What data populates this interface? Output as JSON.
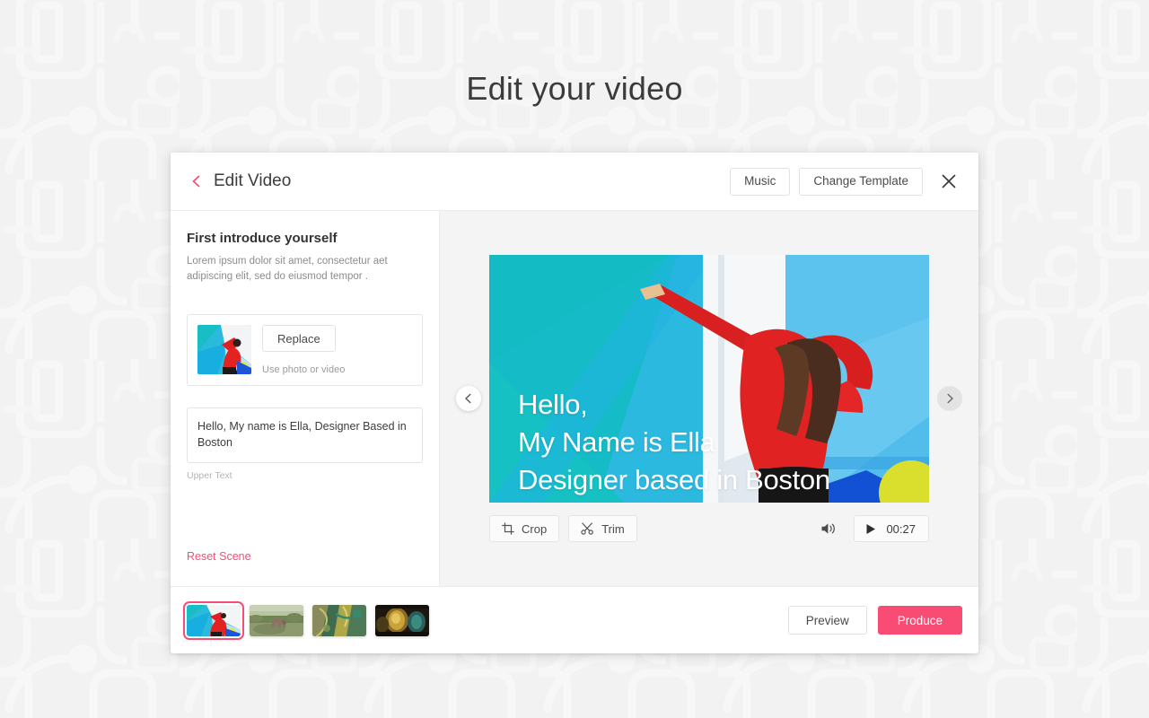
{
  "page": {
    "title": "Edit your video",
    "background_color": "#f2f2f2"
  },
  "modal": {
    "header": {
      "back_icon": "chevron-left-icon",
      "title": "Edit Video",
      "music_label": "Music",
      "change_template_label": "Change Template",
      "close_icon": "close-icon"
    },
    "sidebar": {
      "scene_heading": "First introduce yourself",
      "scene_description": "Lorem ipsum dolor sit amet, consectetur aet adipiscing elit, sed do eiusmod tempor .",
      "media": {
        "thumbnail_name": "scene-media-thumbnail",
        "replace_label": "Replace",
        "replace_hint": "Use photo or video"
      },
      "text_input": {
        "value": "Hello, My name is Ella, Designer Based in Boston",
        "placeholder": "Upper Text",
        "label": "Upper Text"
      },
      "reset_label": "Reset Scene",
      "reset_color": "#f94c75"
    },
    "preview": {
      "prev_icon": "chevron-left-icon",
      "next_icon": "chevron-right-icon",
      "overlay_lines": [
        "Hello,",
        "My Name is Ella",
        "Designer based in Boston"
      ],
      "toolbar": {
        "crop_label": "Crop",
        "crop_icon": "crop-icon",
        "trim_label": "Trim",
        "trim_icon": "scissors-icon",
        "sound_icon": "speaker-icon",
        "play_icon": "play-icon",
        "duration": "00:27"
      }
    },
    "footer": {
      "scenes": [
        {
          "name": "scene-thumbnail-1",
          "selected": true
        },
        {
          "name": "scene-thumbnail-2",
          "selected": false
        },
        {
          "name": "scene-thumbnail-3",
          "selected": false
        },
        {
          "name": "scene-thumbnail-4",
          "selected": false
        }
      ],
      "preview_label": "Preview",
      "produce_label": "Produce",
      "produce_color": "#f94c75"
    }
  }
}
